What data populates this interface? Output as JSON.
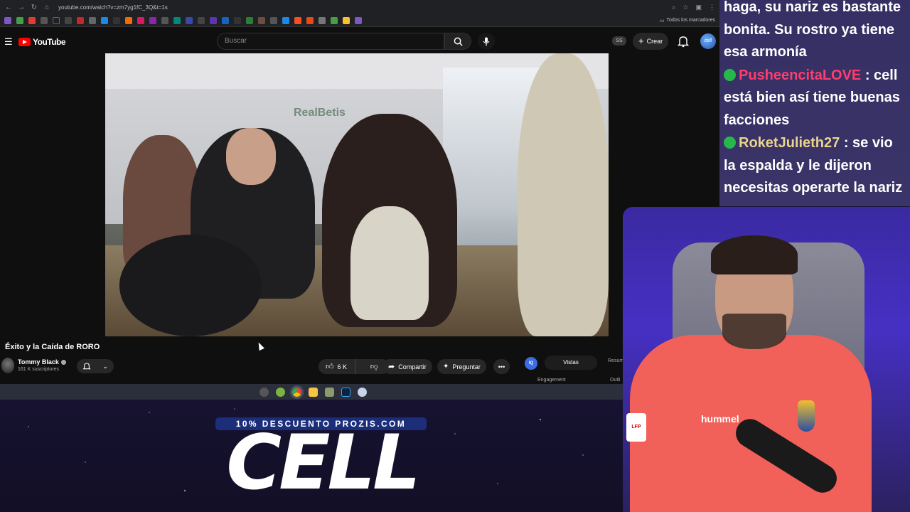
{
  "browser": {
    "url": "youtube.com/watch?v=zm7yg1fC_3Q&t=1s",
    "bookmarks_folder": "Todos los marcadores"
  },
  "youtube": {
    "logo_text": "YouTube",
    "search_placeholder": "Buscar",
    "ss_badge": "SS",
    "create_label": "Crear",
    "video_title": "Éxito y la Caída de RORO",
    "channel_name": "Tommy Black",
    "subscribers": "161 K suscriptores",
    "like_count": "6 K",
    "share_label": "Compartir",
    "ask_label": "Preguntar",
    "panel": {
      "badge": "IQ",
      "tab_active": "Vistas",
      "tab_other": "Resum",
      "label_left": "Engagement",
      "label_right": "Outli"
    }
  },
  "chat": {
    "messages": [
      {
        "user": "",
        "text": "haga, su nariz es bastante bonita. Su rostro ya tiene esa armonía"
      },
      {
        "user": "PusheencitaLOVE",
        "text": " : cell está bien así tiene buenas facciones"
      },
      {
        "user": "RoketJulieth27",
        "text": " : se vio la espalda y le dijeron necesitas operarte la nariz"
      }
    ]
  },
  "webcam": {
    "shirt_brand": "hummel",
    "patch": "LFP"
  },
  "promo": {
    "code_text": "10% DESCUENTO PROZIS.COM",
    "big_text": "CELL"
  },
  "colors": {
    "youtube_red": "#ff0000",
    "chat_bg": "#352f63",
    "username_pink": "#ff3d6e",
    "username_yellow": "#e9d38a",
    "promo_blue": "#1c2e7a"
  }
}
